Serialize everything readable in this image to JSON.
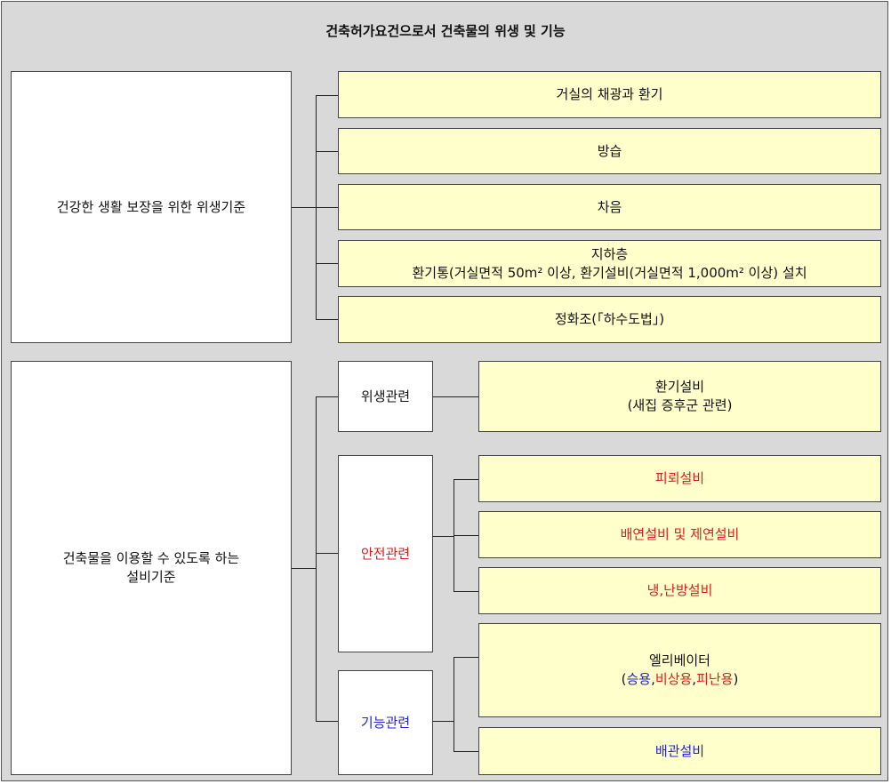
{
  "title": "건축허가요건으로서 건축물의 위생 및 기능",
  "section1": {
    "label": "건강한 생활 보장을 위한 위생기준",
    "items": [
      "거실의 채광과 환기",
      "방습",
      "차음",
      "지하층",
      "환기통(거실면적 50m² 이상, 환기설비(거실면적 1,000m² 이상) 설치",
      "정화조(「하수도법」)"
    ]
  },
  "section2": {
    "label_line1": "건축물을 이용할 수 있도록 하는",
    "label_line2": "설비기준",
    "groups": {
      "hygiene": {
        "label": "위생관련",
        "item_line1": "환기설비",
        "item_line2": "(새집 증후군 관련)"
      },
      "safety": {
        "label": "안전관련",
        "items": [
          "피뢰설비",
          "배연설비 및 제연설비",
          "냉,난방설비"
        ]
      },
      "function": {
        "label": "기능관련",
        "elevator": "엘리베이터",
        "open_paren": "(",
        "passenger": "승용",
        "comma1": ",",
        "emergency": "비상용",
        "comma2": ",",
        "evacuation": "피난용",
        "close_paren": ")",
        "piping": "배관설비"
      }
    }
  },
  "colors": {
    "background": "#d9d9d9",
    "item_fill": "#ffffcc",
    "red": "#e01b1b",
    "blue": "#2222dd"
  }
}
